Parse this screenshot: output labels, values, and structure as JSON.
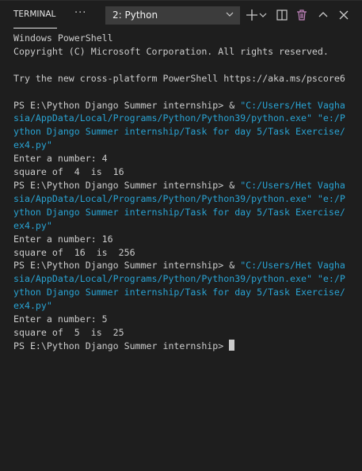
{
  "header": {
    "tab_label": "TERMINAL",
    "more_label": "···",
    "terminal_select": "2: Python"
  },
  "colors": {
    "background": "#1e1e1e",
    "text": "#cccccc",
    "string": "#29a3d3"
  },
  "terminal": {
    "lines": [
      [
        {
          "t": "Windows PowerShell"
        }
      ],
      [
        {
          "t": "Copyright (C) Microsoft Corporation. All rights reserved."
        }
      ],
      [
        {
          "t": ""
        }
      ],
      [
        {
          "t": "Try the new cross-platform PowerShell https://aka.ms/pscore6"
        }
      ],
      [
        {
          "t": ""
        }
      ],
      [
        {
          "t": "PS E:\\Python Django Summer internship> & "
        },
        {
          "t": "\"C:/Users/Het Vagha",
          "c": "cyan"
        }
      ],
      [
        {
          "t": "sia/AppData/Local/Programs/Python/Python39/python.exe\" \"e:/P",
          "c": "cyan"
        }
      ],
      [
        {
          "t": "ython Django Summer internship/Task for day 5/Task Exercise/",
          "c": "cyan"
        }
      ],
      [
        {
          "t": "ex4.py\"",
          "c": "cyan"
        }
      ],
      [
        {
          "t": "Enter a number: 4"
        }
      ],
      [
        {
          "t": "square of  4  is  16"
        }
      ],
      [
        {
          "t": "PS E:\\Python Django Summer internship> & "
        },
        {
          "t": "\"C:/Users/Het Vagha",
          "c": "cyan"
        }
      ],
      [
        {
          "t": "sia/AppData/Local/Programs/Python/Python39/python.exe\" \"e:/P",
          "c": "cyan"
        }
      ],
      [
        {
          "t": "ython Django Summer internship/Task for day 5/Task Exercise/",
          "c": "cyan"
        }
      ],
      [
        {
          "t": "ex4.py\"",
          "c": "cyan"
        }
      ],
      [
        {
          "t": "Enter a number: 16"
        }
      ],
      [
        {
          "t": "square of  16  is  256"
        }
      ],
      [
        {
          "t": "PS E:\\Python Django Summer internship> & "
        },
        {
          "t": "\"C:/Users/Het Vagha",
          "c": "cyan"
        }
      ],
      [
        {
          "t": "sia/AppData/Local/Programs/Python/Python39/python.exe\" \"e:/P",
          "c": "cyan"
        }
      ],
      [
        {
          "t": "ython Django Summer internship/Task for day 5/Task Exercise/",
          "c": "cyan"
        }
      ],
      [
        {
          "t": "ex4.py\"",
          "c": "cyan"
        }
      ],
      [
        {
          "t": "Enter a number: 5"
        }
      ],
      [
        {
          "t": "square of  5  is  25"
        }
      ],
      [
        {
          "t": "PS E:\\Python Django Summer internship> "
        }
      ]
    ]
  }
}
